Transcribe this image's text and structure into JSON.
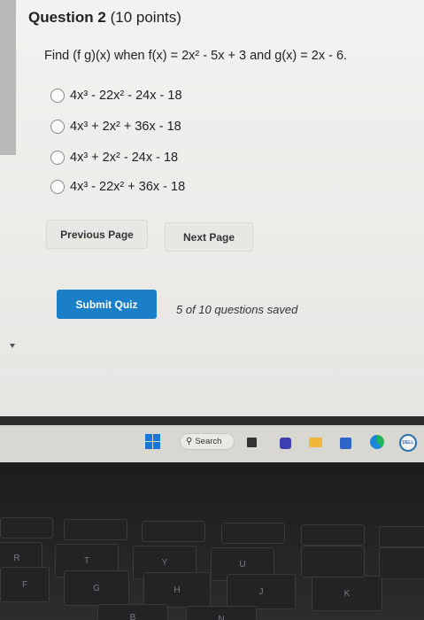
{
  "question": {
    "title": "Question 2",
    "points": "(10 points)",
    "prompt": "Find (f g)(x)  when  f(x) = 2x² - 5x + 3 and g(x) = 2x - 6."
  },
  "options": [
    "4x³ - 22x² - 24x - 18",
    "4x³ + 2x² + 36x - 18",
    "4x³ + 2x² - 24x - 18",
    "4x³ - 22x² + 36x - 18"
  ],
  "navigation": {
    "previous_label": "Previous Page",
    "next_label": "Next Page"
  },
  "submit": {
    "label": "Submit Quiz",
    "status": "5 of 10 questions saved",
    "color": "#1a7fc7"
  },
  "taskbar": {
    "search_label": "Search",
    "dell_label": "DELL",
    "icons": [
      "start-icon",
      "search-icon",
      "widgets-icon",
      "teams-icon",
      "folder-icon",
      "store-icon",
      "edge-icon",
      "dell-icon"
    ]
  },
  "keyboard": {
    "keys": [
      "R",
      "T",
      "Y",
      "U",
      "F",
      "G",
      "H",
      "J",
      "K",
      "B",
      "N"
    ]
  }
}
